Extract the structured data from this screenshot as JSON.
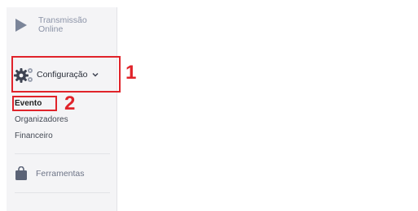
{
  "sidebar": {
    "transmissao": {
      "label": "Transmissão Online",
      "icon": "play-icon"
    },
    "configuracao": {
      "label": "Configuração",
      "icon": "gears-icon",
      "chevron": "chevron-down-icon"
    },
    "sub_items": [
      {
        "label": "Evento",
        "active": true
      },
      {
        "label": "Organizadores"
      },
      {
        "label": "Financeiro"
      }
    ],
    "ferramentas": {
      "label": "Ferramentas",
      "icon": "bag-icon"
    }
  },
  "annotations": {
    "step1": "1",
    "step2": "2",
    "color": "#e0232a"
  }
}
